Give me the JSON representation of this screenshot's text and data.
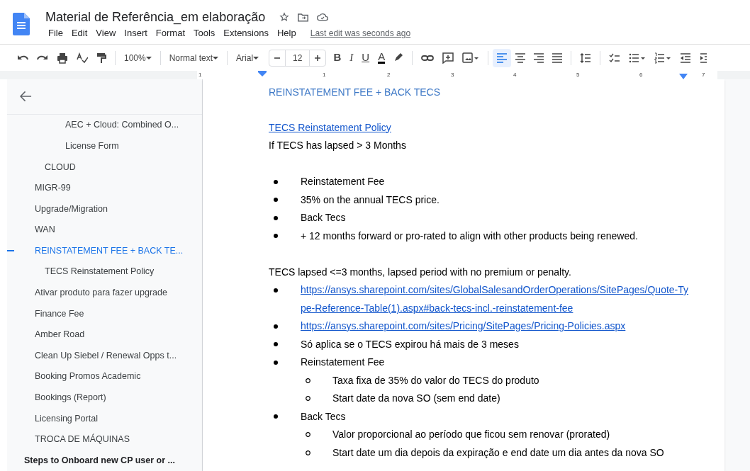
{
  "window": {
    "title": "Material de Referência_em elaboração",
    "last_edit": "Last edit was seconds ago"
  },
  "menu": [
    "File",
    "Edit",
    "View",
    "Insert",
    "Format",
    "Tools",
    "Extensions",
    "Help"
  ],
  "toolbar": {
    "zoom": "100%",
    "style": "Normal text",
    "font": "Arial",
    "font_size": "12",
    "format_buttons": [
      "B",
      "I",
      "U",
      "A"
    ],
    "alignment": [
      {
        "kind": "left",
        "selected": true
      },
      {
        "kind": "center",
        "selected": false
      },
      {
        "kind": "right",
        "selected": false
      },
      {
        "kind": "justify",
        "selected": false
      }
    ]
  },
  "ruler": [
    "1",
    "1",
    "2",
    "3",
    "4",
    "5",
    "6",
    "7"
  ],
  "outline": {
    "items": [
      {
        "children": [
          {
            "children": [
              {
                "children": [
                  {
                    "title": "AEC + Cloud: Combined O...",
                    "selected": false
                  },
                  {
                    "title": "License Form",
                    "selected": false
                  }
                ]
              },
              {
                "title": "CLOUD",
                "selected": false
              }
            ]
          },
          {
            "title": "MIGR-99",
            "selected": false
          },
          {
            "title": "Upgrade/Migration",
            "selected": false
          },
          {
            "title": "WAN",
            "selected": false
          },
          {
            "title": "REINSTATEMENT FEE + BACK TE...",
            "selected": true,
            "children": [
              {
                "title": "TECS Reinstatement Policy",
                "selected": false
              }
            ]
          },
          {
            "title": "Ativar produto para fazer upgrade",
            "selected": false
          },
          {
            "title": "Finance Fee",
            "selected": false
          },
          {
            "title": "Amber Road",
            "selected": false
          },
          {
            "title": "Clean Up Siebel / Renewal Opps t...",
            "selected": false
          },
          {
            "title": "Booking Promos Academic",
            "selected": false
          },
          {
            "title": "Bookings (Report)",
            "selected": false
          },
          {
            "title": "Licensing Portal",
            "selected": false
          },
          {
            "title": "TROCA DE MÁQUINAS",
            "selected": false
          }
        ]
      },
      {
        "title": "Steps to Onboard new CP user or ...",
        "selected": false
      }
    ]
  },
  "document": {
    "blocks": [
      {
        "kind": "heading",
        "text": "REINSTATEMENT FEE + BACK TECS"
      },
      {
        "kind": "blank"
      },
      {
        "kind": "link",
        "text": "TECS Reinstatement Policy"
      },
      {
        "kind": "paragraph",
        "text": "If TECS has lapsed > 3 Months"
      },
      {
        "kind": "blank"
      },
      {
        "kind": "list",
        "items": [
          {
            "kind": "text",
            "text": "Reinstatement Fee"
          },
          {
            "kind": "text",
            "text": "35% on the annual TECS price."
          },
          {
            "kind": "text",
            "text": "Back Tecs"
          },
          {
            "kind": "text",
            "text": "+ 12 months forward or pro-rated to align with other products being renewed."
          }
        ]
      },
      {
        "kind": "blank"
      },
      {
        "kind": "paragraph",
        "text": "TECS lapsed <=3 months, lapsed period with no premium or penalty."
      },
      {
        "kind": "list",
        "items": [
          {
            "kind": "link",
            "text": "https://ansys.sharepoint.com/sites/GlobalSalesandOrderOperations/SitePages/Quote-Type-Reference-Table(1).aspx#back-tecs-incl.-reinstatement-fee"
          },
          {
            "kind": "link",
            "text": "https://ansys.sharepoint.com/sites/Pricing/SitePages/Pricing-Policies.aspx"
          },
          {
            "kind": "text",
            "text": "Só aplica se o TECS expirou há mais de 3 meses"
          },
          {
            "kind": "text",
            "text": "Reinstatement Fee",
            "children": [
              {
                "kind": "text",
                "text": "Taxa fixa de 35% do valor do TECS do produto"
              },
              {
                "kind": "text",
                "text": "Start date da nova SO (sem end date)"
              }
            ]
          },
          {
            "kind": "text",
            "text": "Back Tecs",
            "children": [
              {
                "kind": "text",
                "text": "Valor proporcional ao período que ficou sem renovar (prorated)"
              },
              {
                "kind": "text",
                "text": "Start date um dia depois da expiração e end date um dia antes da nova SO"
              }
            ]
          }
        ]
      }
    ]
  }
}
